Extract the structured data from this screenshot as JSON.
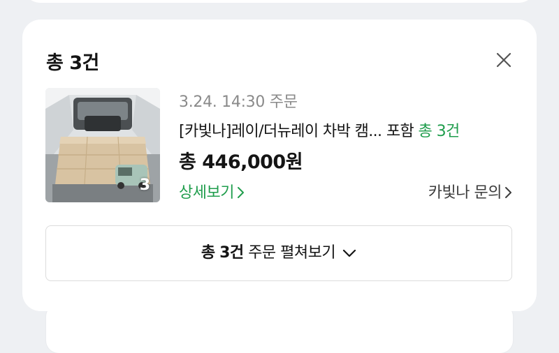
{
  "header": {
    "count_prefix": "총",
    "count": "3건",
    "close_icon": "close-icon"
  },
  "order": {
    "date": "3.24. 14:30 주문",
    "title": "[카빛나]레이/더뉴레이 차박 캠...",
    "included_prefix": "포함",
    "included_count": "총 3건",
    "price": "총 446,000원",
    "thumbnail_count": "3"
  },
  "links": {
    "detail": "상세보기",
    "inquiry": "카빛나 문의"
  },
  "expand_button": {
    "prefix": "총",
    "count": "3건",
    "label": "주문 펼쳐보기"
  },
  "colors": {
    "accent_green": "#1f9d4c",
    "text_dark": "#141414",
    "text_muted": "#8a8a8a",
    "page_bg": "#eef0f3"
  }
}
